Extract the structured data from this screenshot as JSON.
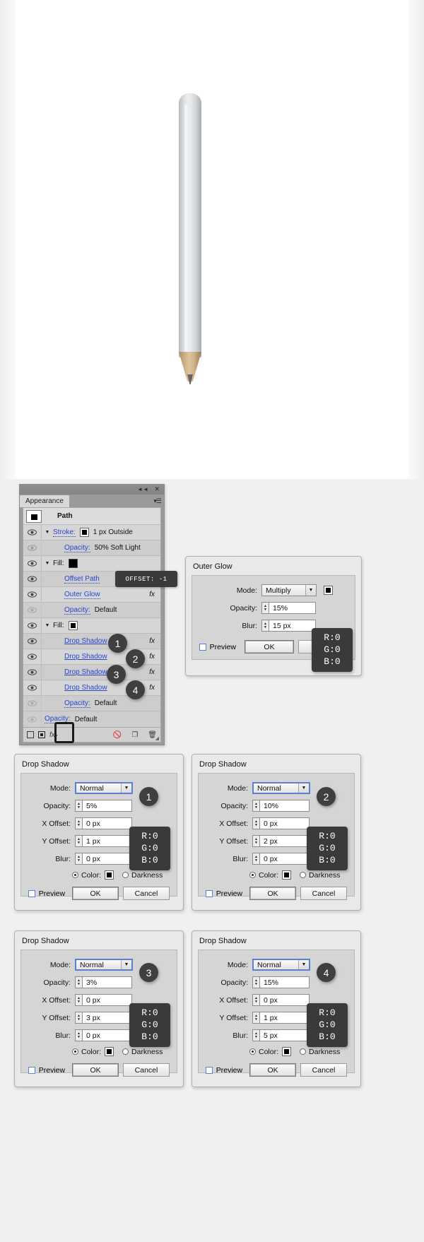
{
  "canvas": {
    "artwork": "pencil-illustration"
  },
  "appearance_panel": {
    "tab_label": "Appearance",
    "collapse_icon": "collapse-arrows-icon",
    "close_icon": "close-icon",
    "menu_icon": "panel-menu-icon",
    "rows": [
      {
        "type": "header",
        "label": "Path",
        "eye": false,
        "thumb": true
      },
      {
        "type": "item",
        "label": "Stroke:",
        "link": true,
        "swatch": true,
        "value": "1 px  Outside",
        "triangle": true,
        "eye": true,
        "fx": false
      },
      {
        "type": "sub",
        "label": "Opacity:",
        "link": true,
        "value": "50% Soft Light",
        "eye": true,
        "fx": false
      },
      {
        "type": "item",
        "label": "Fill:",
        "link": false,
        "swatch": true,
        "value": "",
        "triangle": true,
        "eye": true,
        "fx": false
      },
      {
        "type": "sub",
        "label": "Offset Path",
        "link": true,
        "value": "",
        "eye": true,
        "fx": false
      },
      {
        "type": "sub",
        "label": "Outer Glow",
        "link": true,
        "value": "",
        "eye": true,
        "fx": true
      },
      {
        "type": "sub",
        "label": "Opacity:",
        "link": true,
        "value": "Default",
        "eye": false,
        "fx": false
      },
      {
        "type": "item",
        "label": "Fill:",
        "link": false,
        "swatch": true,
        "value": "",
        "triangle": true,
        "eye": true,
        "fx": false
      },
      {
        "type": "sub",
        "label": "Drop Shadow",
        "link": true,
        "value": "",
        "eye": true,
        "fx": true,
        "badge": "1"
      },
      {
        "type": "sub",
        "label": "Drop Shadow",
        "link": true,
        "value": "",
        "eye": true,
        "fx": true,
        "badge": "2"
      },
      {
        "type": "sub",
        "label": "Drop Shadow",
        "link": true,
        "value": "",
        "eye": true,
        "fx": true,
        "badge": "3"
      },
      {
        "type": "sub",
        "label": "Drop Shadow",
        "link": true,
        "value": "",
        "eye": true,
        "fx": true,
        "badge": "4"
      },
      {
        "type": "sub",
        "label": "Opacity:",
        "link": true,
        "value": "Default",
        "eye": false,
        "fx": false
      },
      {
        "type": "subroot",
        "label": "Opacity:",
        "link": true,
        "value": "Default",
        "eye": false,
        "fx": false
      }
    ],
    "footer": {
      "new_stroke_icon": "new-stroke-icon",
      "new_fill_icon": "new-fill-icon",
      "fx_label": "fx",
      "fx_arrow_icon": "fx-dropdown-icon",
      "clear_icon": "clear-appearance-icon",
      "duplicate_icon": "duplicate-item-icon",
      "delete_icon": "delete-item-icon",
      "resize_icon": "resize-grip-icon"
    }
  },
  "offset_tooltip": {
    "text": "OFFSET: -1"
  },
  "dialogs": [
    {
      "id": "outer-glow",
      "title": "Outer Glow",
      "mode_label": "Mode:",
      "mode_value": "Multiply",
      "opacity_label": "Opacity:",
      "opacity_value": "15%",
      "blur_label": "Blur:",
      "blur_value": "15 px",
      "preview_label": "Preview",
      "ok_label": "OK",
      "cancel_label": "Cancel",
      "color_swatch": "#000000",
      "rgb": {
        "r": "R:0",
        "g": "G:0",
        "b": "B:0"
      }
    },
    {
      "id": "drop-shadow-1",
      "badge": "1",
      "title": "Drop Shadow",
      "mode_label": "Mode:",
      "mode_value": "Normal",
      "opacity_label": "Opacity:",
      "opacity_value": "5%",
      "xoffset_label": "X Offset:",
      "xoffset_value": "0 px",
      "yoffset_label": "Y Offset:",
      "yoffset_value": "1 px",
      "blur_label": "Blur:",
      "blur_value": "0 px",
      "color_label": "Color:",
      "darkness_label": "Darkness",
      "preview_label": "Preview",
      "ok_label": "OK",
      "cancel_label": "Cancel",
      "color_swatch": "#000000",
      "rgb": {
        "r": "R:0",
        "g": "G:0",
        "b": "B:0"
      }
    },
    {
      "id": "drop-shadow-2",
      "badge": "2",
      "title": "Drop Shadow",
      "mode_label": "Mode:",
      "mode_value": "Normal",
      "opacity_label": "Opacity:",
      "opacity_value": "10%",
      "xoffset_label": "X Offset:",
      "xoffset_value": "0 px",
      "yoffset_label": "Y Offset:",
      "yoffset_value": "2 px",
      "blur_label": "Blur:",
      "blur_value": "0 px",
      "color_label": "Color:",
      "darkness_label": "Darkness",
      "preview_label": "Preview",
      "ok_label": "OK",
      "cancel_label": "Cancel",
      "color_swatch": "#000000",
      "rgb": {
        "r": "R:0",
        "g": "G:0",
        "b": "B:0"
      }
    },
    {
      "id": "drop-shadow-3",
      "badge": "3",
      "title": "Drop Shadow",
      "mode_label": "Mode:",
      "mode_value": "Normal",
      "opacity_label": "Opacity:",
      "opacity_value": "3%",
      "xoffset_label": "X Offset:",
      "xoffset_value": "0 px",
      "yoffset_label": "Y Offset:",
      "yoffset_value": "3 px",
      "blur_label": "Blur:",
      "blur_value": "0 px",
      "color_label": "Color:",
      "darkness_label": "Darkness",
      "preview_label": "Preview",
      "ok_label": "OK",
      "cancel_label": "Cancel",
      "color_swatch": "#000000",
      "rgb": {
        "r": "R:0",
        "g": "G:0",
        "b": "B:0"
      }
    },
    {
      "id": "drop-shadow-4",
      "badge": "4",
      "title": "Drop Shadow",
      "mode_label": "Mode:",
      "mode_value": "Normal",
      "opacity_label": "Opacity:",
      "opacity_value": "15%",
      "xoffset_label": "X Offset:",
      "xoffset_value": "0 px",
      "yoffset_label": "Y Offset:",
      "yoffset_value": "1 px",
      "blur_label": "Blur:",
      "blur_value": "5 px",
      "color_label": "Color:",
      "darkness_label": "Darkness",
      "preview_label": "Preview",
      "ok_label": "OK",
      "cancel_label": "Cancel",
      "color_swatch": "#000000",
      "rgb": {
        "r": "R:0",
        "g": "G:0",
        "b": "B:0"
      }
    }
  ]
}
